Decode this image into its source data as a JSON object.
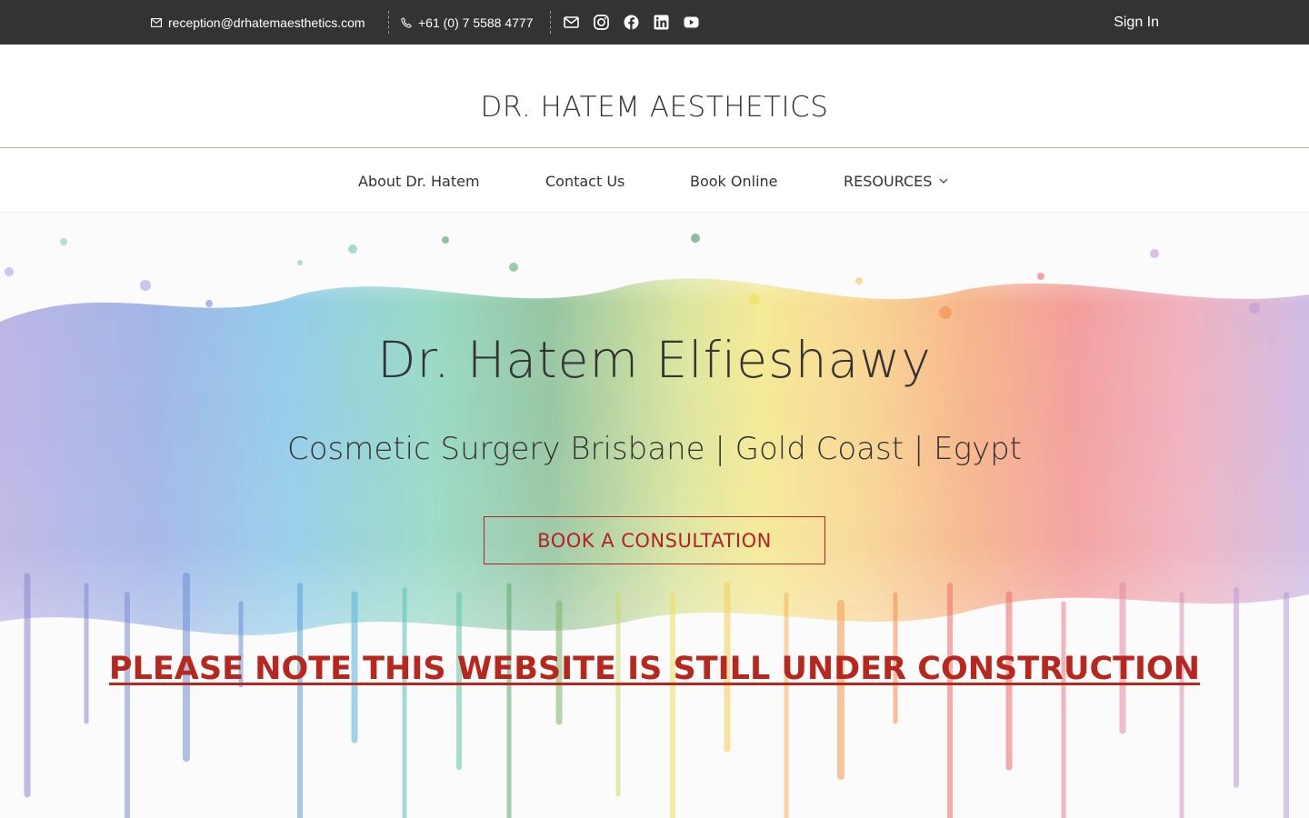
{
  "topbar": {
    "email": "reception@drhatemaesthetics.com",
    "phone": "+61 (0) 7 5588 4777",
    "social": [
      "mail-icon",
      "instagram-icon",
      "facebook-icon",
      "linkedin-icon",
      "youtube-icon"
    ],
    "sign_in": "Sign In"
  },
  "brand": {
    "title": "DR. HATEM AESTHETICS"
  },
  "nav": {
    "items": [
      {
        "label": "About Dr. Hatem"
      },
      {
        "label": "Contact Us"
      },
      {
        "label": "Book Online"
      },
      {
        "label": "RESOURCES"
      }
    ]
  },
  "hero": {
    "name": "Dr. Hatem Elfieshawy",
    "subtitle": "Cosmetic Surgery Brisbane | Gold Coast | Egypt",
    "cta": "BOOK A CONSULTATION",
    "notice": "PLEASE NOTE THIS WEBSITE IS STILL UNDER CONSTRUCTION"
  },
  "colors": {
    "topbar_bg": "#333333",
    "accent_red": "#b32226",
    "notice_red": "#b8271d",
    "brand_divider": "#d7a08a"
  }
}
